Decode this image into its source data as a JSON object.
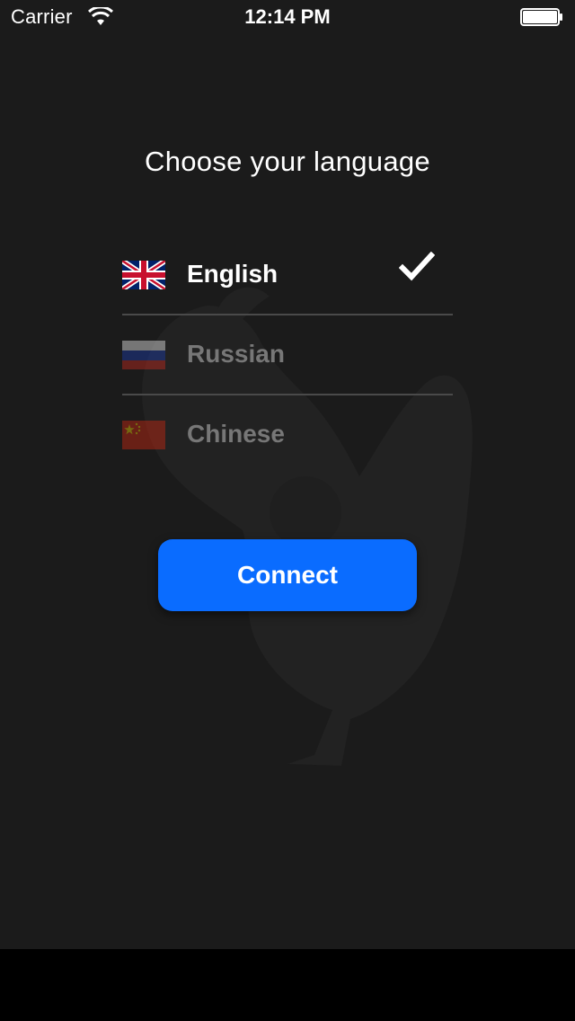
{
  "status_bar": {
    "carrier": "Carrier",
    "time": "12:14 PM",
    "wifi_icon": "wifi-icon",
    "battery_icon": "battery-icon"
  },
  "title": "Choose your language",
  "languages": [
    {
      "label": "English",
      "flag_icon": "uk-flag-icon",
      "selected": true
    },
    {
      "label": "Russian",
      "flag_icon": "russia-flag-icon",
      "selected": false
    },
    {
      "label": "Chinese",
      "flag_icon": "china-flag-icon",
      "selected": false
    }
  ],
  "check_icon": "checkmark-icon",
  "connect_label": "Connect",
  "colors": {
    "background": "#1b1b1b",
    "accent": "#0a6cff",
    "active_text": "#ffffff",
    "inactive_text": "#777777"
  }
}
